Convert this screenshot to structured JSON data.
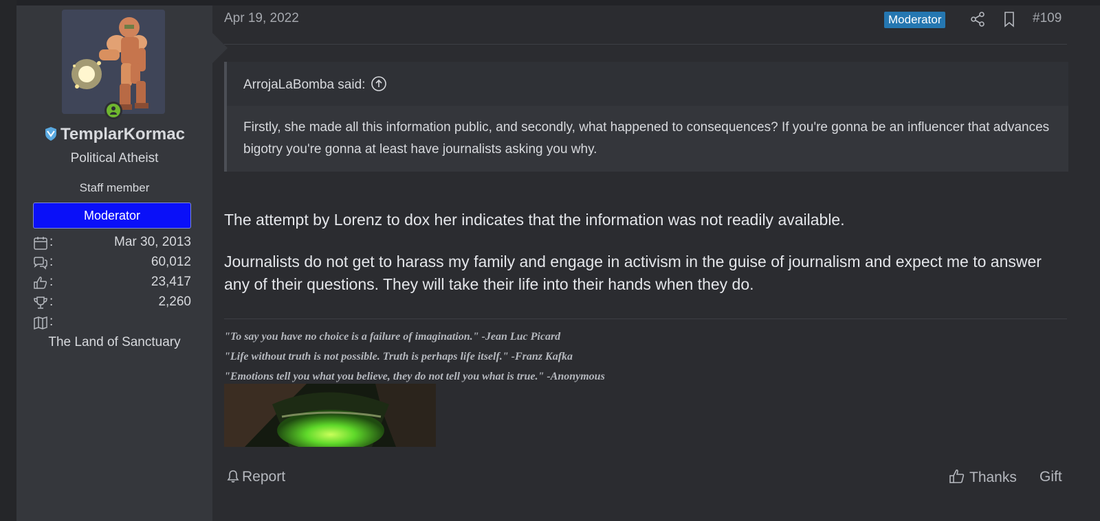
{
  "user": {
    "username": "TemplarKormac",
    "user_title": "Political Atheist",
    "staff_label": "Staff member",
    "banner": "Moderator",
    "stats": [
      {
        "icon": "calendar-icon",
        "colon": ":",
        "value": "Mar 30, 2013"
      },
      {
        "icon": "messages-icon",
        "colon": ":",
        "value": "60,012"
      },
      {
        "icon": "thumbs-up-icon",
        "colon": ":",
        "value": "23,417"
      },
      {
        "icon": "trophy-icon",
        "colon": ":",
        "value": "2,260"
      },
      {
        "icon": "map-icon",
        "colon": ":",
        "value": ""
      }
    ],
    "location": "The Land of Sanctuary"
  },
  "post": {
    "date": "Apr 19, 2022",
    "badge": "Moderator",
    "number": "#109",
    "quote": {
      "author": "ArrojaLaBomba said:",
      "text": "Firstly, she made all this information public, and secondly, what happened to consequences? If you're gonna be an influencer that advances bigotry you're gonna at least have journalists asking you why."
    },
    "paragraphs": [
      "The attempt by Lorenz to dox her indicates that the information was not readily available.",
      "Journalists do not get to harass my family and engage in activism in the guise of journalism and expect me to answer any of their questions. They will take their life into their hands when they do."
    ],
    "signature": [
      "\"To say you have no choice is a failure of imagination.\" -Jean Luc Picard",
      "\"Life without truth is not possible. Truth is perhaps life itself.\" -Franz Kafka",
      "\"Emotions tell you what you believe, they do not tell you what is true.\" -Anonymous"
    ]
  },
  "actions": {
    "report": "Report",
    "thanks": "Thanks",
    "gift": "Gift"
  },
  "colors": {
    "moderator_banner": "#0a10f8",
    "moderator_badge": "#2577b1",
    "online_indicator": "#6fb62f"
  }
}
